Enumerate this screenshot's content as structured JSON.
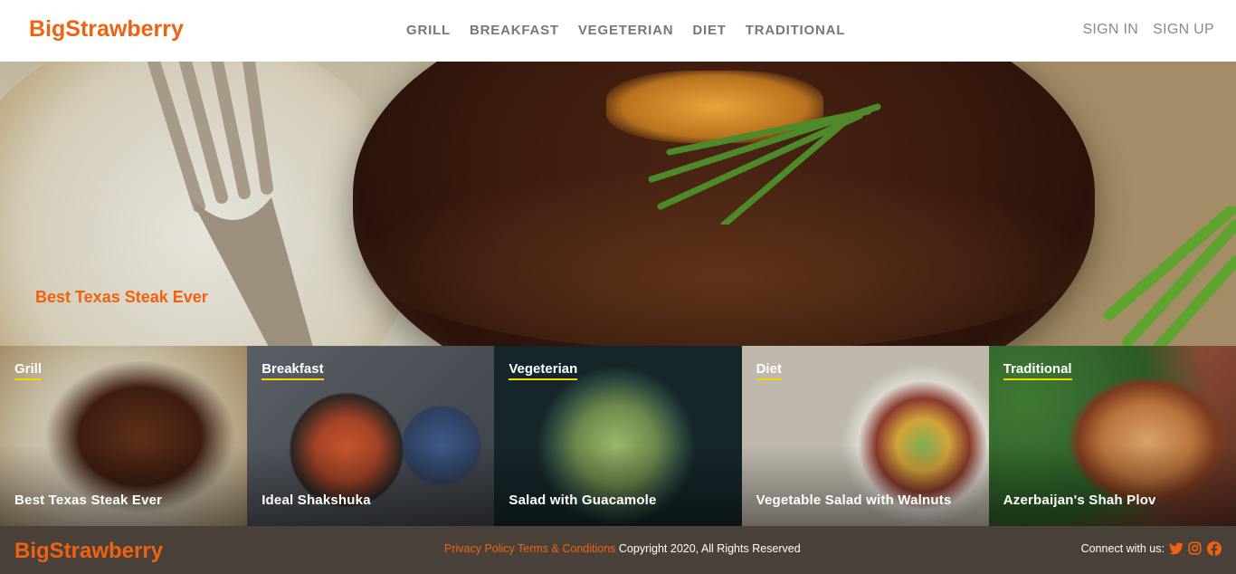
{
  "header": {
    "logo": "BigStrawberry",
    "nav": [
      "GRILL",
      "BREAKFAST",
      "VEGETERIAN",
      "DIET",
      "TRADITIONAL"
    ],
    "sign_in": "SIGN IN",
    "sign_up": "SIGN UP"
  },
  "hero": {
    "title": "Best Texas Steak Ever"
  },
  "tiles": [
    {
      "category": "Grill",
      "dish": "Best Texas Steak Ever"
    },
    {
      "category": "Breakfast",
      "dish": "Ideal Shakshuka"
    },
    {
      "category": "Vegeterian",
      "dish": "Salad with Guacamole"
    },
    {
      "category": "Diet",
      "dish": "Vegetable Salad with Walnuts"
    },
    {
      "category": "Traditional",
      "dish": "Azerbaijan's Shah Plov"
    }
  ],
  "footer": {
    "logo": "BigStrawberry",
    "privacy": "Privacy Policy",
    "terms": "Terms & Conditions",
    "copyright": "Copyright 2020, All Rights Reserved",
    "connect": "Connect with us:",
    "icons": [
      "twitter-icon",
      "instagram-icon",
      "facebook-icon"
    ]
  },
  "colors": {
    "brand": "#f0620f",
    "footer_bg": "#4a413b",
    "underline": "#f5d400"
  }
}
